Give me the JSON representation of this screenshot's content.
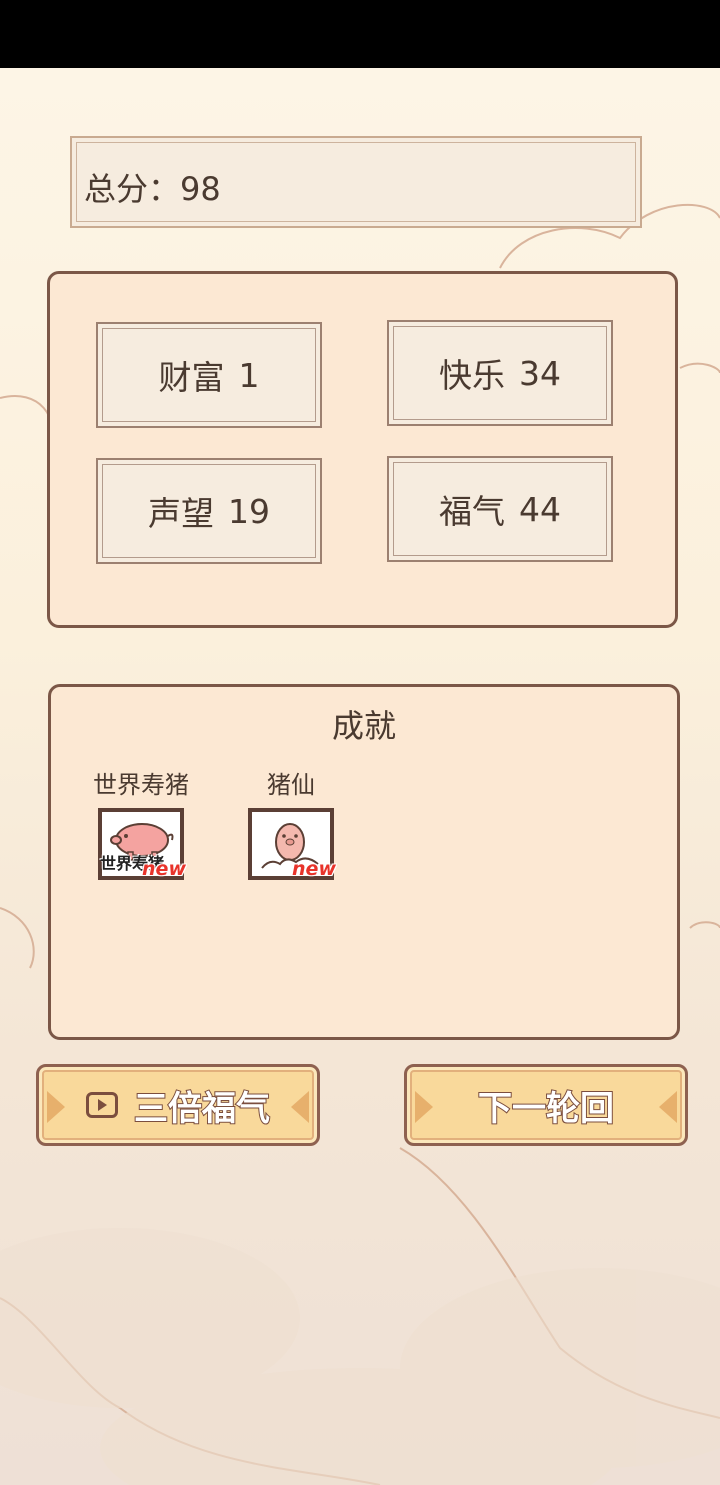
{
  "score": {
    "label": "总分：",
    "value": "98"
  },
  "stats": [
    {
      "label": "财富",
      "value": "1"
    },
    {
      "label": "快乐",
      "value": "34"
    },
    {
      "label": "声望",
      "value": "19"
    },
    {
      "label": "福气",
      "value": "44"
    }
  ],
  "achievements": {
    "title": "成就",
    "items": [
      {
        "name": "世界寿猪",
        "image_text": "世界寿猪",
        "badge": "new",
        "icon": "pig-icon"
      },
      {
        "name": "猪仙",
        "badge": "new",
        "icon": "immortal-pig-icon"
      }
    ]
  },
  "buttons": {
    "triple": {
      "label": "三倍福气",
      "icon": "video-icon"
    },
    "next": {
      "label": "下一轮回"
    }
  },
  "colors": {
    "panel_bg": "#fce8d3",
    "panel_border": "#7b5747",
    "button_bg": "#f9d99b",
    "badge_new": "#e8332a"
  }
}
